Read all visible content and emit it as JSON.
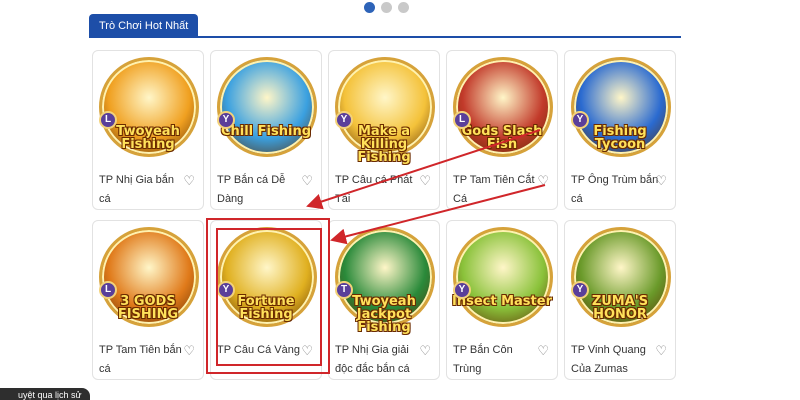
{
  "carousel": {
    "active_index": 0,
    "count": 3
  },
  "section": {
    "title": "Trò Chơi Hot Nhất"
  },
  "colors": {
    "accent": "#1d4ea8",
    "highlight": "#d0262a",
    "badge": "#5a3f9a"
  },
  "games": [
    {
      "title": "TP Nhị Gia bắn cá",
      "logo": "Twoyeah Fishing",
      "badge": "L",
      "theme": "#f0a020"
    },
    {
      "title": "TP Bắn cá Dễ Dàng",
      "logo": "Chill Fishing",
      "badge": "Y",
      "theme": "#3aa0e0"
    },
    {
      "title": "TP Câu cá Phát Tài",
      "logo": "Make a Killing Fishing",
      "badge": "Y",
      "theme": "#f4c23a"
    },
    {
      "title": "TP Tam Tiên Cắt Cá",
      "logo": "Gods Slash Fish",
      "badge": "L",
      "theme": "#c23a2a"
    },
    {
      "title": "TP Ông Trùm bắn cá",
      "logo": "Fishing Tycoon",
      "badge": "Y",
      "theme": "#2a6ad0"
    },
    {
      "title": "TP Tam Tiên bắn cá",
      "logo": "3 GODS FISHING",
      "badge": "L",
      "theme": "#e07a1a"
    },
    {
      "title": "TP Câu Cá Vàng",
      "logo": "Fortune Fishing",
      "badge": "Y",
      "theme": "#e0b020"
    },
    {
      "title": "TP Nhị Gia giải độc đắc bắn cá",
      "logo": "Twoyeah Jackpot Fishing",
      "badge": "T",
      "theme": "#2a8a3a"
    },
    {
      "title": "TP Bắn Côn Trùng",
      "logo": "Insect Master",
      "badge": "Y",
      "theme": "#8ac23a"
    },
    {
      "title": "TP Vinh Quang Của Zumas",
      "logo": "ZUMA'S HONOR",
      "badge": "Y",
      "theme": "#6a9a2a"
    }
  ],
  "history_label": "uyệt qua lịch sử"
}
